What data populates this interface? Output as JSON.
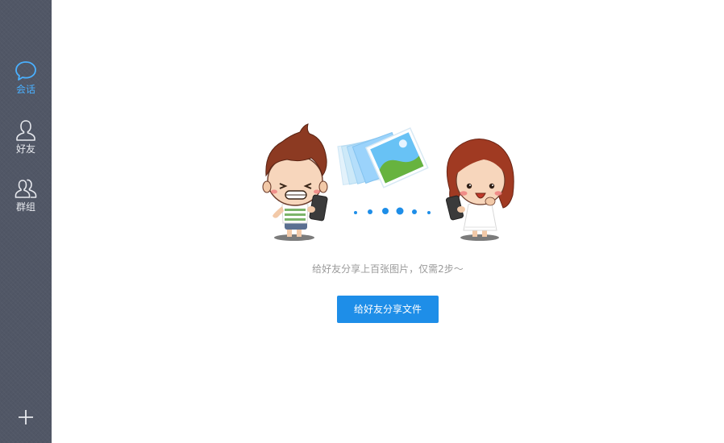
{
  "sidebar": {
    "items": [
      {
        "id": "chat",
        "label": "会话",
        "icon": "chat-bubble-icon",
        "active": true
      },
      {
        "id": "friends",
        "label": "好友",
        "icon": "person-icon",
        "active": false
      },
      {
        "id": "groups",
        "label": "群组",
        "icon": "people-icon",
        "active": false
      }
    ],
    "add_icon": "plus-icon",
    "active_color": "#4ab0ff",
    "background": "#515766"
  },
  "main": {
    "illustration_icons": [
      "boy-with-phone-illustration",
      "photo-stack-illustration",
      "transfer-dots",
      "girl-with-phone-illustration"
    ],
    "hint": "给好友分享上百张图片，仅需2步～",
    "button_label": "给好友分享文件",
    "button_color": "#1e8ee8"
  }
}
